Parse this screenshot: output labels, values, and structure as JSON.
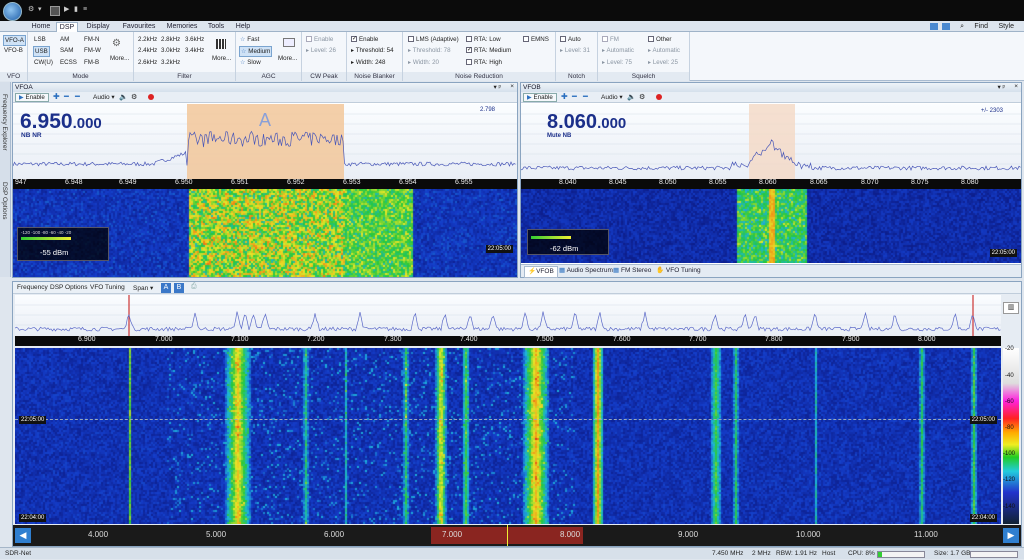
{
  "app": {
    "status_name": "SDR-Net"
  },
  "titlebar": {
    "right_tools": [
      "Find",
      "Style"
    ]
  },
  "tabs": [
    "Home",
    "DSP",
    "Display",
    "Favourites",
    "Memories",
    "Tools",
    "Help"
  ],
  "active_tab": "DSP",
  "ribbon": {
    "vfo": {
      "label": "VFO",
      "items": [
        "VFO-A",
        "VFO-B"
      ]
    },
    "mode": {
      "label": "Mode",
      "col1": [
        "LSB",
        "USB",
        "CW(U)"
      ],
      "col2": [
        "AM",
        "SAM",
        "ECSS"
      ],
      "col3": [
        "FM-N",
        "FM-W",
        "FM-B"
      ],
      "more": "More..."
    },
    "filter": {
      "label": "Filter",
      "col1": [
        "2.2kHz",
        "2.4kHz",
        "2.6kHz"
      ],
      "col2": [
        "2.8kHz",
        "3.0kHz",
        "3.2kHz"
      ],
      "col3": [
        "3.6kHz",
        "3.4kHz"
      ],
      "more": "More..."
    },
    "agc": {
      "label": "AGC",
      "items": [
        "Fast",
        "Medium",
        "Slow"
      ],
      "more": "More..."
    },
    "cwpeak": {
      "label": "CW Peak",
      "items": [
        "Enable",
        "Level: 26"
      ]
    },
    "nb": {
      "label": "Noise Blanker",
      "items": [
        "Enable",
        "Threshold: 54",
        "Width: 248"
      ]
    },
    "nr": {
      "label": "Noise Reduction",
      "col1": [
        "LMS (Adaptive)",
        "Threshold: 78",
        "Width: 20"
      ],
      "col2": [
        "RTA: Low",
        "RTA: Medium",
        "RTA: High"
      ],
      "col3": [
        "EMNS"
      ]
    },
    "notch": {
      "label": "Notch",
      "items": [
        "Auto",
        "Level: 31"
      ]
    },
    "squelch": {
      "label": "Squelch",
      "col1": [
        "FM",
        "Automatic",
        "Level: 75"
      ],
      "col2": [
        "Other",
        "Automatic",
        "Level: 25"
      ]
    }
  },
  "sidebar": [
    "Frequency Explorer",
    "DSP Options"
  ],
  "vfoa": {
    "title": "VFOA",
    "enable": "Enable",
    "audio": "Audio",
    "freq_main": "6.950",
    "freq_sub": ".000",
    "mode": "NB NR",
    "marker": "A",
    "offset": "2.798",
    "ticks": [
      "947",
      "6.948",
      "6.949",
      "6.950",
      "6.951",
      "6.952",
      "6.953",
      "6.954",
      "6.955"
    ],
    "signal": "-55 dBm",
    "time": "22:05:00",
    "meter_scale": "-120  -100  -80  -60  -40  -20"
  },
  "vfob": {
    "title": "VFOB",
    "enable": "Enable",
    "audio": "Audio",
    "freq_main": "8.060",
    "freq_sub": ".000",
    "mode": "Mute NB",
    "offset": "+/- 2303",
    "ticks": [
      "8.040",
      "8.045",
      "8.050",
      "8.055",
      "8.060",
      "8.065",
      "8.070",
      "8.075",
      "8.080"
    ],
    "signal": "-62 dBm",
    "time": "22:05:00",
    "bottom_tabs": [
      "VFOB",
      "Audio Spectrum",
      "FM Stereo",
      "VFO Tuning"
    ]
  },
  "main": {
    "toolbar": [
      "Frequency",
      "DSP Options",
      "VFO Tuning",
      "Span"
    ],
    "vfo_buttons": [
      "A",
      "B"
    ],
    "ticks": [
      "6.900",
      "7.000",
      "7.100",
      "7.200",
      "7.300",
      "7.400",
      "7.500",
      "7.600",
      "7.700",
      "7.800",
      "7.900",
      "8.000"
    ],
    "db_ticks": [
      "-20",
      "-40",
      "-60",
      "-80",
      "-100",
      "-120",
      "-140"
    ],
    "time_top": "22:05:00",
    "time_bottom": "22:04:00",
    "band_ticks": [
      "4.000",
      "5.000",
      "6.000",
      "7.000",
      "8.000",
      "9.000",
      "10.000",
      "11.000"
    ]
  },
  "status": {
    "freq": "7.450 MHz",
    "span": "2 MHz",
    "rbw": "RBW: 1.91 Hz",
    "host": "Host",
    "cpu": "CPU: 8%",
    "size": "Size: 1.7 GB",
    "cpu_level": 0.08
  }
}
